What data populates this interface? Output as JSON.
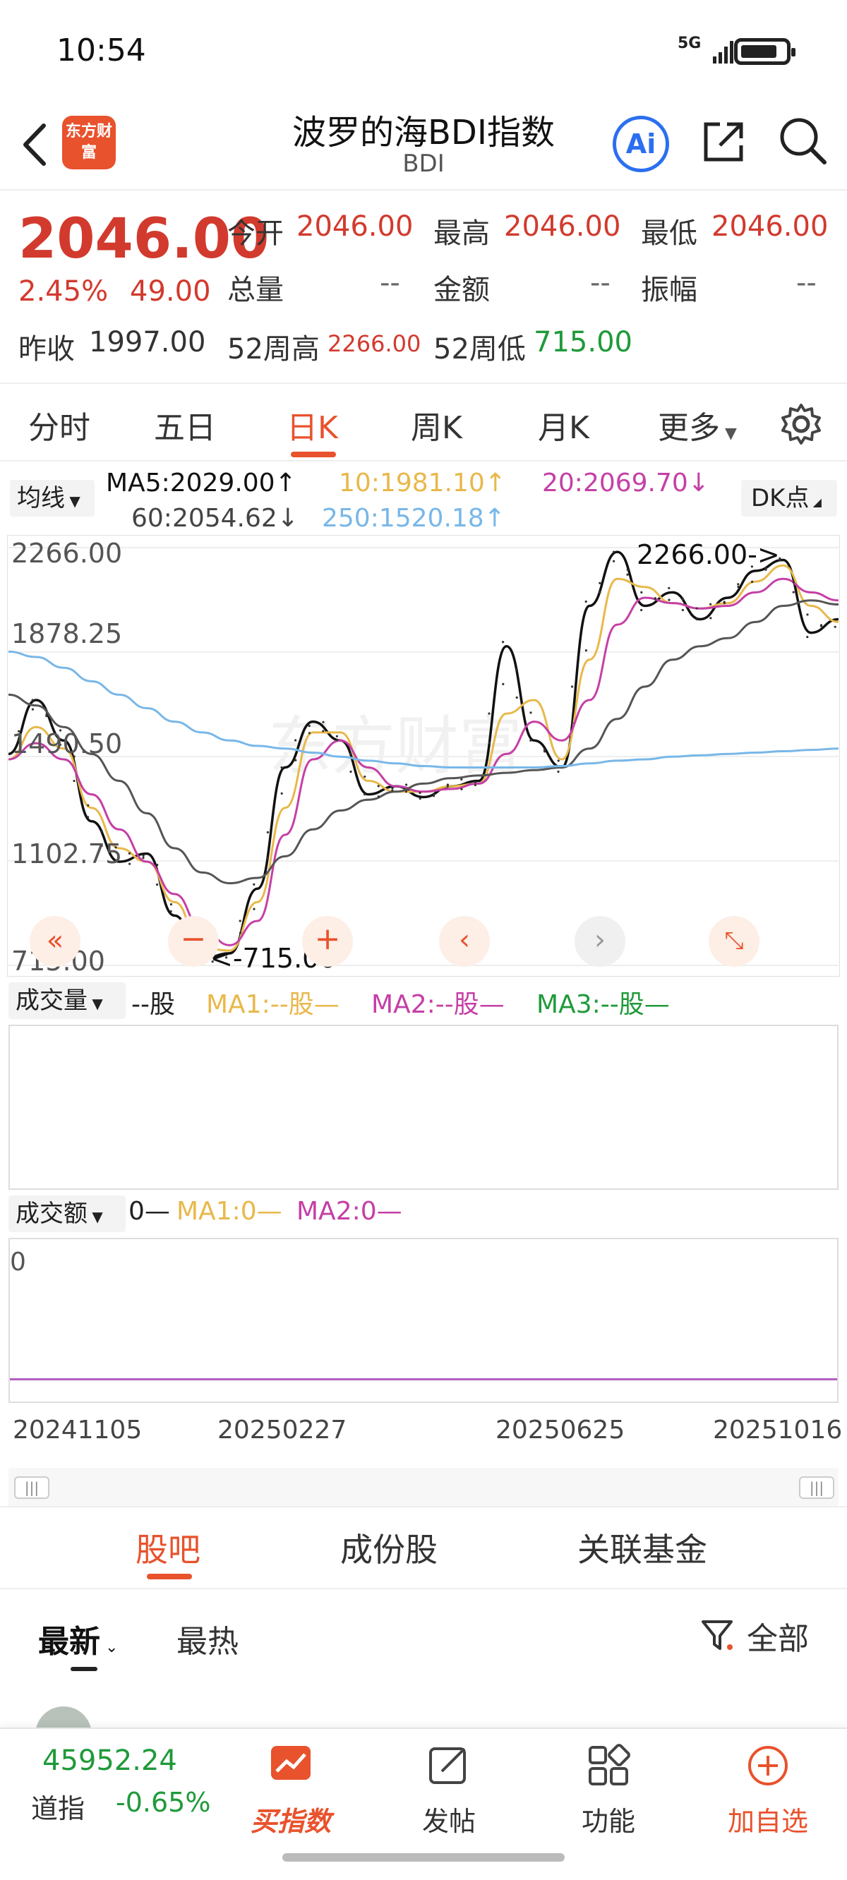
{
  "status": {
    "time": "10:54",
    "network": "5G"
  },
  "nav": {
    "logo": "东方财富",
    "title": "波罗的海BDI指数",
    "subtitle": "BDI",
    "ai_label": "Ai"
  },
  "quote": {
    "price": "2046.00",
    "change_pct": "2.45%",
    "change": "49.00",
    "open_label": "今开",
    "open": "2046.00",
    "high_label": "最高",
    "high": "2046.00",
    "low_label": "最低",
    "low": "2046.00",
    "volume_label": "总量",
    "volume": "--",
    "amount_label": "金额",
    "amount": "--",
    "amplitude_label": "振幅",
    "amplitude": "--",
    "prev_close_label": "昨收",
    "prev_close": "1997.00",
    "w52_high_label": "52周高",
    "w52_high": "2266.00",
    "w52_low_label": "52周低",
    "w52_low": "715.00"
  },
  "ktabs": [
    "分时",
    "五日",
    "日K",
    "周K",
    "月K",
    "更多"
  ],
  "ma": {
    "select": "均线",
    "ma5": "MA5:2029.00↑",
    "ma10": "10:1981.10↑",
    "ma20": "20:2069.70↓",
    "ma60": "60:2054.62↓",
    "ma250": "250:1520.18↑",
    "dk": "DK点"
  },
  "colors": {
    "ma5": "#111111",
    "ma10": "#e8b84a",
    "ma20": "#c53fa6",
    "ma60": "#555555",
    "ma250": "#78b7e8",
    "up": "#d23a2e",
    "down": "#1f9a3a",
    "accent": "#e8522c"
  },
  "chart_data": {
    "type": "line",
    "ylim": [
      715.0,
      2266.0
    ],
    "y_ticks": [
      "2266.00",
      "1878.25",
      "1490.50",
      "1102.75",
      "715.00"
    ],
    "x_ticks": [
      "20241105",
      "20250227",
      "20250625",
      "20251016"
    ],
    "annotations": [
      "2266.00->",
      "<-715.00"
    ],
    "series": [
      {
        "name": "MA5",
        "values": [
          1500,
          1700,
          1550,
          1250,
          1100,
          1130,
          900,
          740,
          760,
          1000,
          1450,
          1620,
          1550,
          1350,
          1380,
          1340,
          1380,
          1400,
          1900,
          1550,
          1450,
          2050,
          2250,
          2050,
          2100,
          2000,
          2080,
          2180,
          2220,
          1950,
          2000
        ]
      },
      {
        "name": "10",
        "values": [
          1480,
          1600,
          1520,
          1300,
          1150,
          1100,
          950,
          780,
          770,
          950,
          1300,
          1580,
          1580,
          1400,
          1360,
          1360,
          1380,
          1390,
          1650,
          1700,
          1480,
          1850,
          2150,
          2120,
          2060,
          2040,
          2060,
          2140,
          2200,
          2050,
          1990
        ]
      },
      {
        "name": "20",
        "values": [
          1480,
          1540,
          1480,
          1350,
          1220,
          1100,
          980,
          850,
          790,
          880,
          1200,
          1480,
          1550,
          1450,
          1380,
          1360,
          1370,
          1390,
          1500,
          1620,
          1550,
          1700,
          1980,
          2080,
          2060,
          2040,
          2050,
          2100,
          2150,
          2100,
          2070
        ]
      },
      {
        "name": "60",
        "values": [
          1720,
          1680,
          1600,
          1500,
          1400,
          1280,
          1150,
          1060,
          1020,
          1040,
          1120,
          1220,
          1290,
          1330,
          1360,
          1390,
          1410,
          1420,
          1430,
          1440,
          1450,
          1520,
          1630,
          1750,
          1850,
          1900,
          1930,
          1990,
          2050,
          2070,
          2055
        ]
      },
      {
        "name": "250",
        "values": [
          1880,
          1860,
          1820,
          1770,
          1720,
          1670,
          1620,
          1580,
          1550,
          1530,
          1520,
          1505,
          1490,
          1475,
          1465,
          1455,
          1450,
          1450,
          1450,
          1450,
          1455,
          1465,
          1475,
          1480,
          1490,
          1495,
          1500,
          1505,
          1510,
          1515,
          1520
        ]
      }
    ]
  },
  "volume": {
    "select": "成交量",
    "value": "--股",
    "ma1": "MA1:--股—",
    "ma2": "MA2:--股—",
    "ma3": "MA3:--股—"
  },
  "amount": {
    "select": "成交额",
    "value": "0—",
    "ma1": "MA1:0—",
    "ma2": "MA2:0—",
    "zero": "0"
  },
  "subtabs": [
    "股吧",
    "成份股",
    "关联基金"
  ],
  "feedtabs": [
    "最新",
    "最热"
  ],
  "filter": "全部",
  "bottom": {
    "dji_value": "45952.24",
    "dji_name": "道指",
    "dji_change": "-0.65%",
    "items": [
      "买指数",
      "发帖",
      "功能",
      "加自选"
    ]
  }
}
